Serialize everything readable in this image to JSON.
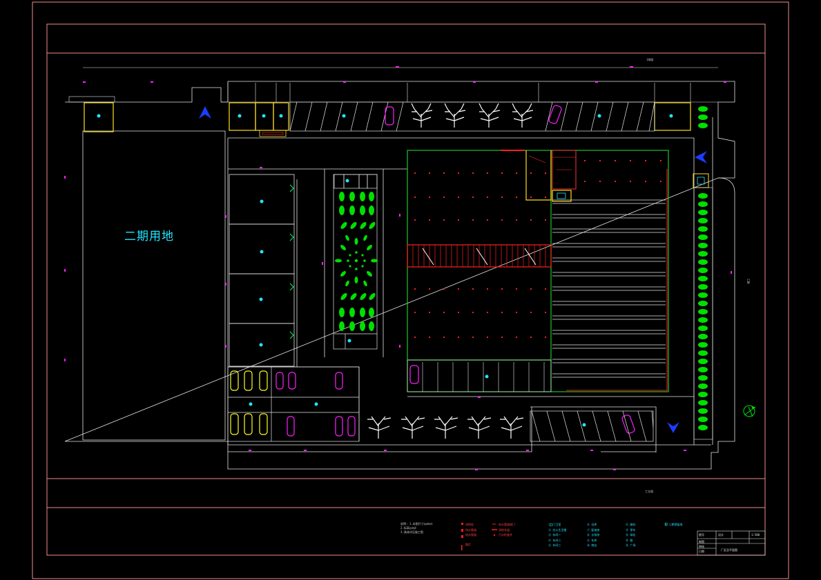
{
  "drawing": {
    "phase_two_label": "二期用地",
    "road_label_top": "1姆路",
    "road_label_right": "工路",
    "road_label_bottom": "工业路",
    "compass_label": "N"
  },
  "notes": {
    "lines": [
      "说明: 1.本图尺寸以mm计",
      "2.标高以m计",
      "3.具体详见施工图"
    ]
  },
  "legend": {
    "red_items": [
      "消防栓",
      "排水管道",
      "给水管道",
      "路灯"
    ],
    "red_items_2": [
      "给水管道阀门",
      "消防车道",
      "污水检查井"
    ],
    "col1": [
      "① 门卫室",
      "② 办公生活楼",
      "③ 车间一",
      "④ 车间二",
      "⑤ 车间三"
    ],
    "col2": [
      "⑥ 仓库",
      "⑦ 配电房",
      "⑧ 水泵房",
      "⑨ 车库",
      "⑩ 商店"
    ],
    "col3": [
      "⑪ 废料",
      "⑫ 停车",
      "⑬ 绿化",
      "⑭ 路",
      "⑮ 广场"
    ],
    "col4": [
      "⑯ 二期预留地"
    ]
  },
  "title_block": {
    "drawing_name": "厂区总平面图",
    "sheet": "图号",
    "scale": "1:500",
    "cells": [
      "设计",
      "制图",
      "审核",
      "日期"
    ]
  },
  "colors": {
    "frame": "#f28c8c",
    "building_outline": "#e8e8e8",
    "fire_lane": "#ff2020",
    "warehouse_border": "#22c22c",
    "tree": "#00e000",
    "car_magenta": "#ff20ff",
    "car_yellow": "#ffff20",
    "label_cyan": "#22e5ff",
    "arrow_blue": "#1a3cff",
    "gate_yellow": "#ffe020"
  }
}
